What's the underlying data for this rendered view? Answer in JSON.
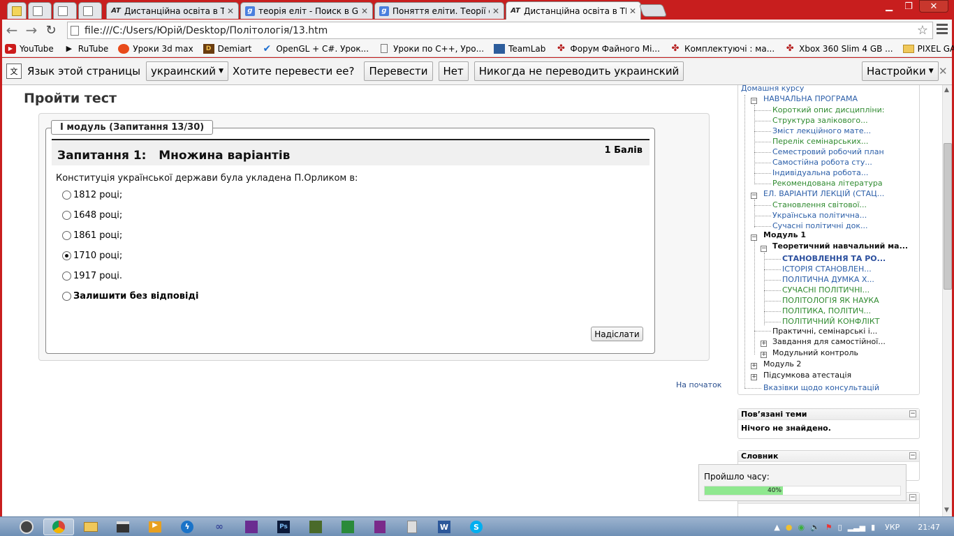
{
  "browser": {
    "tabs": [
      {
        "title": "",
        "icon": "doc-icon"
      },
      {
        "title": "",
        "icon": "doc-icon"
      },
      {
        "title": "",
        "icon": "doc-icon"
      },
      {
        "title": "Дистанційна освіта в ТНТ",
        "icon": "at-logo"
      },
      {
        "title": "теорія еліт - Поиск в Goo",
        "icon": "google-icon"
      },
      {
        "title": "Поняття еліти. Теорії еліт",
        "icon": "google-icon"
      },
      {
        "title": "Дистанційна освіта в ТНТ",
        "icon": "at-logo",
        "active": true
      }
    ],
    "address": "file:///C:/Users/Юрій/Desktop/Політологія/13.htm",
    "bookmarks": [
      {
        "label": "YouTube",
        "icon": "youtube-icon"
      },
      {
        "label": "RuTube",
        "icon": "rutube-icon"
      },
      {
        "label": "Уроки 3d max",
        "icon": "3dmax-icon"
      },
      {
        "label": "Demiart",
        "icon": "demiart-icon"
      },
      {
        "label": "OpenGL + C#. Урок...",
        "icon": "check-icon"
      },
      {
        "label": "Уроки по C++, Уро...",
        "icon": "page-icon"
      },
      {
        "label": "TeamLab",
        "icon": "teamlab-icon"
      },
      {
        "label": "Форум Файного Мі...",
        "icon": "forum-icon"
      },
      {
        "label": "Комплектуючі : ма...",
        "icon": "forum-icon"
      },
      {
        "label": "Xbox 360 Slim 4 GB ...",
        "icon": "forum-icon"
      },
      {
        "label": "PIXEL GAMES",
        "icon": "folder-icon"
      }
    ],
    "translate": {
      "lang_label": "Язык этой страницы",
      "lang_value": "украинский",
      "question": "Хотите перевести ее?",
      "translate_btn": "Перевести",
      "no_btn": "Нет",
      "never_btn": "Никогда не переводить украинский",
      "settings_btn": "Настройки"
    }
  },
  "page": {
    "heading": "Пройти тест",
    "legend": "І модуль (Запитання 13/30)",
    "question_title": "Запитання 1:   Множина варіантів",
    "points": "1 Балів",
    "question_text": "Конституція української держави була укладена П.Орликом в:",
    "options": [
      {
        "label": "1812 році;",
        "checked": false
      },
      {
        "label": "1648 році;",
        "checked": false
      },
      {
        "label": "1861 році;",
        "checked": false
      },
      {
        "label": "1710 році;",
        "checked": true
      },
      {
        "label": "1917 році.",
        "checked": false
      },
      {
        "label": "Залишити без відповіді",
        "checked": false
      }
    ],
    "submit_label": "Надіслати",
    "to_top": "На початок"
  },
  "sidebar": {
    "home": "Домашня курсу",
    "tree": [
      "НАВЧАЛЬНА ПРОГРАМА",
      "Короткий опис дисципліни:",
      "Структура залікового...",
      "Зміст лекційного мате...",
      "Перелік семінарських...",
      "Семестровий робочий план",
      "Самостійна робота сту...",
      "Індивідуальна робота...",
      "Рекомендована література",
      "ЕЛ. ВАРІАНТИ ЛЕКЦІЙ (СТАЦ...",
      "Становлення світової...",
      "Українська політична...",
      "Сучасні політичні док...",
      "Модуль 1",
      "Теоретичний навчальний ма...",
      "СТАНОВЛЕННЯ ТА РО...",
      "ІСТОРІЯ СТАНОВЛЕН...",
      "ПОЛІТИЧНА ДУМКА Х...",
      "СУЧАСНІ ПОЛІТИЧНІ...",
      "ПОЛІТОЛОГІЯ ЯК НАУКА",
      "ПОЛІТИКА, ПОЛІТИЧ...",
      "ПОЛІТИЧНИЙ КОНФЛІКТ",
      "Практичні, семінарські і...",
      "Завдання для самостійної...",
      "Модульний контроль",
      "Модуль 2",
      "Підсумкова атестація",
      "Вказівки щодо консультацій"
    ],
    "related_title": "Пов’язані теми",
    "related_body": "Нічого не знайдено.",
    "glossary_title": "Словник",
    "timer_label": "Пройшло часу:",
    "timer_text": "40%",
    "timer_fraction": 0.4
  },
  "taskbar": {
    "lang": "УКР",
    "time": "21:47"
  }
}
